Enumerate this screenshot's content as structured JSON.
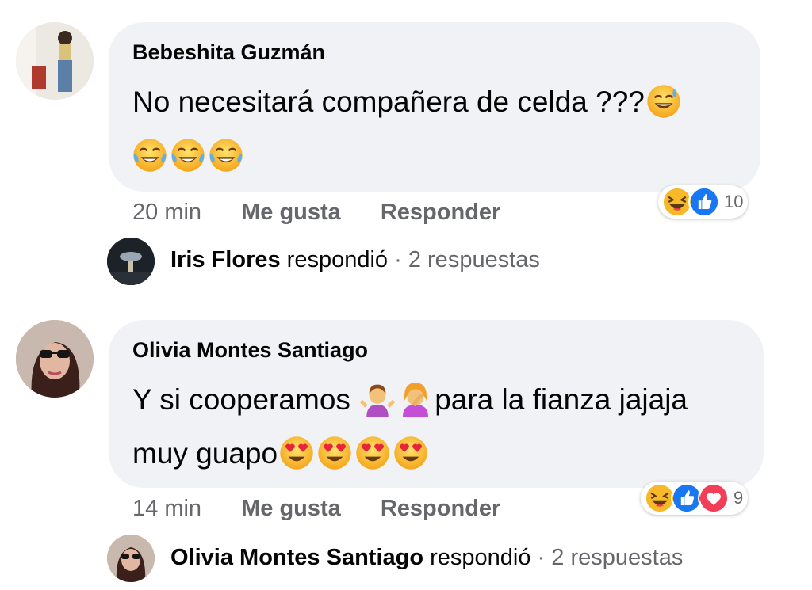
{
  "comments": [
    {
      "author": "Bebeshita Guzmán",
      "line1": "No necesitará compañera de celda ???",
      "time": "20 min",
      "like_label": "Me gusta",
      "reply_label": "Responder",
      "reaction_count": "10",
      "reactions": [
        "haha",
        "like"
      ],
      "reply": {
        "name": "Iris Flores",
        "verb": " respondió",
        "sep": " · ",
        "count": "2 respuestas"
      }
    },
    {
      "author": "Olivia Montes Santiago",
      "line1a": "Y si cooperamos ",
      "line1b": "para la fianza jajaja",
      "line2": "muy guapo",
      "time": "14 min",
      "like_label": "Me gusta",
      "reply_label": "Responder",
      "reaction_count": "9",
      "reactions": [
        "haha",
        "like",
        "love"
      ],
      "reply": {
        "name": "Olivia Montes Santiago",
        "verb": " respondió",
        "sep": " · ",
        "count": "2 respuestas"
      }
    }
  ],
  "colors": {
    "bubble": "#f0f2f5",
    "meta_text": "#65676b",
    "like_blue": "#1877f2",
    "love_red": "#f33e58",
    "haha_yellow": "#f7b928"
  }
}
